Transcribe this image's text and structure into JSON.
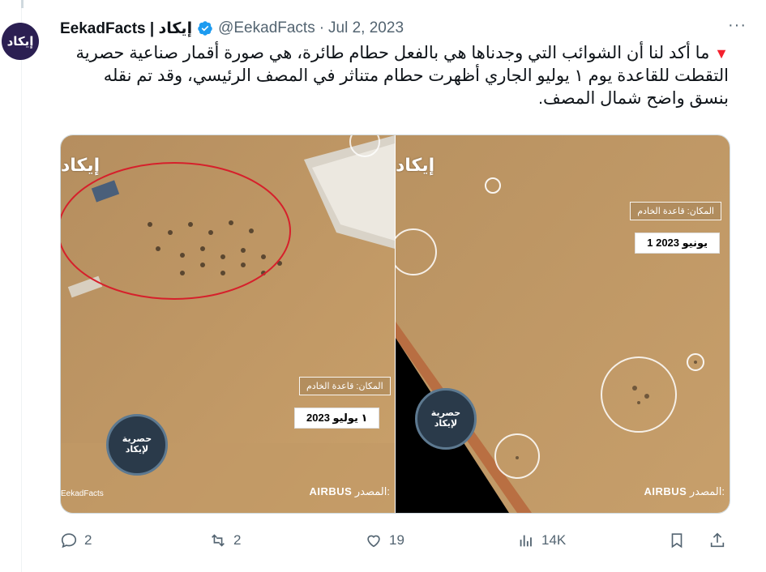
{
  "tweet": {
    "author_name": "EekadFacts | إيكاد",
    "avatar_text": "إيكاد",
    "handle": "@EekadFacts",
    "separator": "·",
    "date": "Jul 2, 2023",
    "more": "···",
    "text": "ما أكد لنا أن الشوائب التي وجدناها هي بالفعل حطام طائرة، هي صورة أقمار صناعية حصرية التقطت للقاعدة يوم ١ يوليو الجاري أظهرت حطام متناثر في المصف الرئيسي، وقد تم نقله بنسق واضح شمال المصف."
  },
  "media": {
    "left": {
      "logo": "إيكاد",
      "location": "المكان: قاعدة الخادم",
      "date_label": "١ يوليو 2023",
      "seal_line1": "حصرية",
      "seal_line2": "لإيكاد",
      "social": "EekadFacts",
      "source_label": "المصدر:",
      "source_brand": "AIRBUS"
    },
    "right": {
      "logo": "إيكاد",
      "location": "المكان: قاعدة الخادم",
      "date_label": "1 يونيو 2023",
      "seal_line1": "حصرية",
      "seal_line2": "لإيكاد",
      "source_label": "المصدر:",
      "source_brand": "AIRBUS"
    }
  },
  "actions": {
    "replies": "2",
    "reposts": "2",
    "likes": "19",
    "views": "14K"
  },
  "colors": {
    "verified": "#1d9bf0",
    "text_secondary": "#536471",
    "desert": "#c9a06a"
  }
}
